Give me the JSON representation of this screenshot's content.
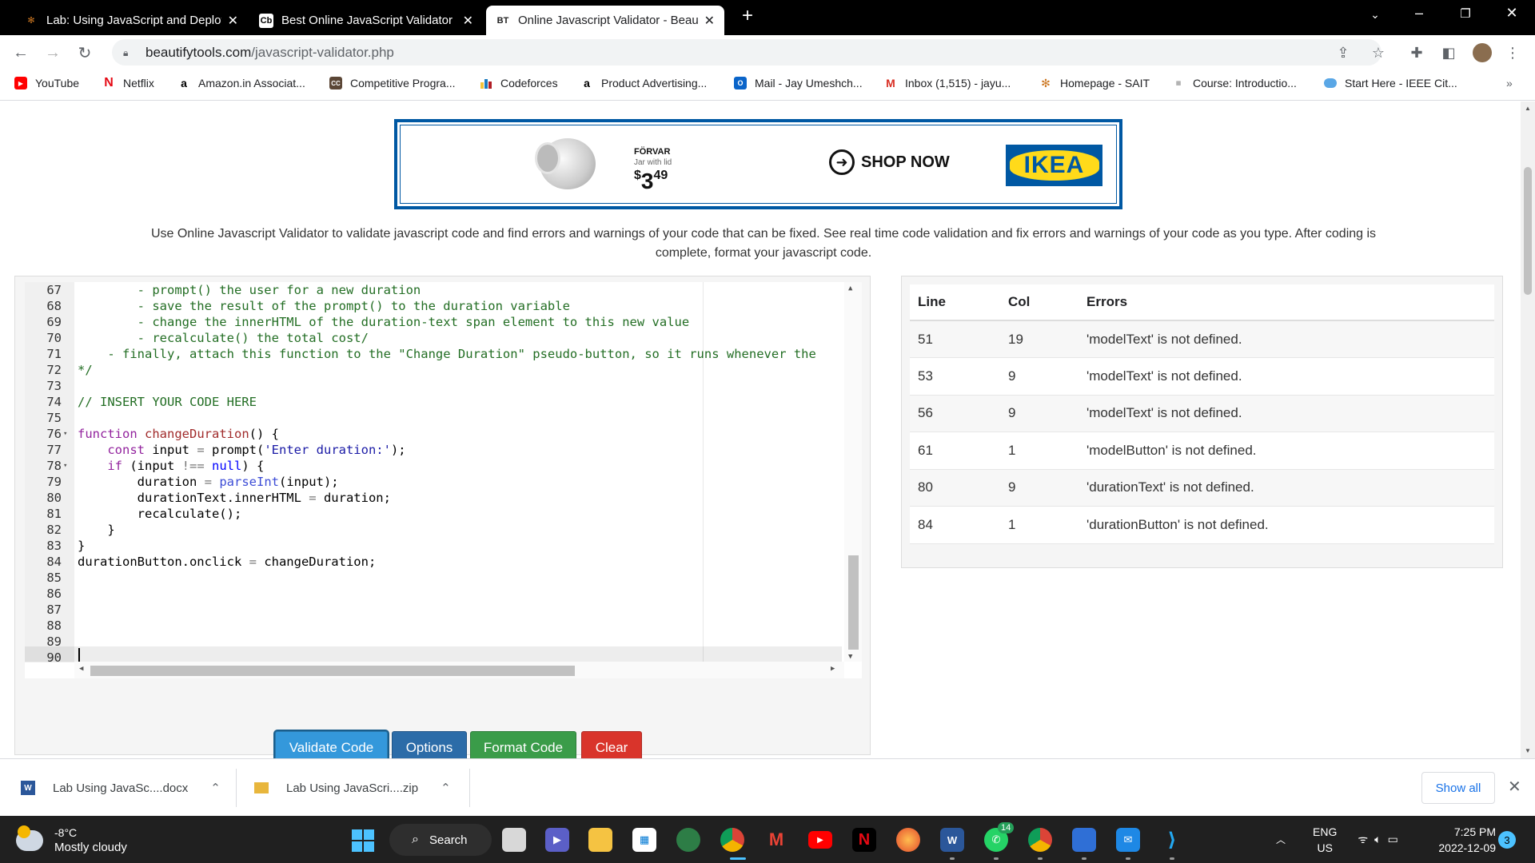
{
  "browser": {
    "tabs": [
      {
        "title": "Lab: Using JavaScript and Deploy",
        "favicon": "sait-icon",
        "active": false
      },
      {
        "title": "Best Online JavaScript Validator",
        "favicon": "cb-icon",
        "active": false
      },
      {
        "title": "Online Javascript Validator - Beau",
        "favicon": "bt-icon",
        "active": true
      }
    ],
    "new_tab": "+",
    "url_host": "beautifytools.com",
    "url_path": "/javascript-validator.php",
    "bookmarks": [
      {
        "label": "YouTube",
        "icon": "youtube-icon"
      },
      {
        "label": "Netflix",
        "icon": "netflix-icon"
      },
      {
        "label": "Amazon.in Associat...",
        "icon": "amazon-icon"
      },
      {
        "label": "Competitive Progra...",
        "icon": "cc-icon"
      },
      {
        "label": "Codeforces",
        "icon": "codeforces-icon"
      },
      {
        "label": "Product Advertising...",
        "icon": "amazon-icon"
      },
      {
        "label": "Mail - Jay Umeshch...",
        "icon": "outlook-icon"
      },
      {
        "label": "Inbox (1,515) - jayu...",
        "icon": "gmail-icon"
      },
      {
        "label": "Homepage - SAIT",
        "icon": "sait-icon"
      },
      {
        "label": "Course: Introductio...",
        "icon": "course-icon"
      },
      {
        "label": "Start Here - IEEE Cit...",
        "icon": "cloud-icon"
      }
    ],
    "bookmarks_more": "»"
  },
  "ad": {
    "product_name": "FÖRVAR",
    "product_desc": "Jar with lid",
    "price_symbol": "$",
    "price_main": "3",
    "price_cents": "49",
    "cta": "SHOP NOW",
    "brand": "IKEA",
    "brand_color": "#0058a3",
    "brand_yellow": "#ffda1a"
  },
  "intro_text": "Use Online Javascript Validator to validate javascript code and find errors and warnings of your code that can be fixed. See real time code validation and fix errors and warnings of your code as you type. After coding is complete, format your javascript code.",
  "editor": {
    "line_numbers": [
      "67",
      "68",
      "69",
      "70",
      "71",
      "72",
      "73",
      "74",
      "75",
      "76",
      "77",
      "78",
      "79",
      "80",
      "81",
      "82",
      "83",
      "84",
      "85",
      "86",
      "87",
      "88",
      "89",
      "90"
    ],
    "fold_markers": {
      "76": "▾",
      "78": "▾"
    },
    "comment_lines": [
      "        - prompt() the user for a new duration",
      "        - save the result of the prompt() to the duration variable",
      "        - change the innerHTML of the duration-text span element to this new value",
      "        - recalculate() the total cost/",
      "    - finally, attach this function to the \"Change Duration\" pseudo-button, so it runs whenever the",
      "*/"
    ],
    "insert_comment": "// INSERT YOUR CODE HERE"
  },
  "buttons": {
    "validate": "Validate Code",
    "options": "Options",
    "format": "Format Code",
    "clear": "Clear"
  },
  "errors": {
    "headers": [
      "Line",
      "Col",
      "Errors"
    ],
    "rows": [
      {
        "line": "51",
        "col": "19",
        "msg": "'modelText' is not defined."
      },
      {
        "line": "53",
        "col": "9",
        "msg": "'modelText' is not defined."
      },
      {
        "line": "56",
        "col": "9",
        "msg": "'modelText' is not defined."
      },
      {
        "line": "61",
        "col": "1",
        "msg": "'modelButton' is not defined."
      },
      {
        "line": "80",
        "col": "9",
        "msg": "'durationText' is not defined."
      },
      {
        "line": "84",
        "col": "1",
        "msg": "'durationButton' is not defined."
      }
    ]
  },
  "downloads": {
    "items": [
      {
        "name": "Lab Using JavaSc....docx",
        "icon": "word-doc-icon"
      },
      {
        "name": "Lab Using JavaScri....zip",
        "icon": "zip-folder-icon"
      }
    ],
    "show_all": "Show all"
  },
  "taskbar": {
    "temp": "-8°C",
    "condition": "Mostly cloudy",
    "search": "Search",
    "whatsapp_badge": "14",
    "lang": "ENG",
    "region": "US",
    "time": "7:25 PM",
    "date": "2022-12-09",
    "notifications": "3"
  }
}
